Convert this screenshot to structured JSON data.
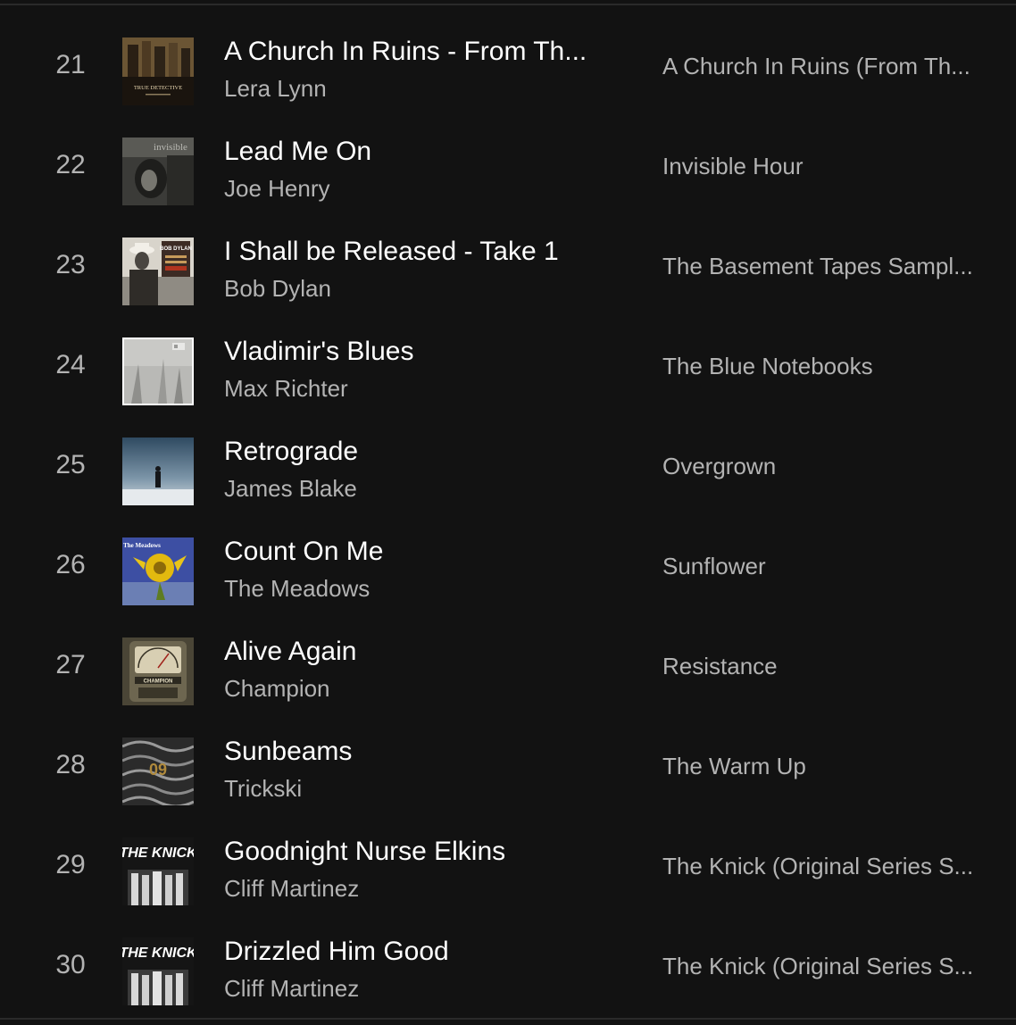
{
  "tracks": [
    {
      "number": "21",
      "title": "A Church In Ruins - From Th...",
      "artist": "Lera Lynn",
      "album": "A Church In Ruins (From Th...",
      "art_icon": "true-detective-album-art"
    },
    {
      "number": "22",
      "title": "Lead Me On",
      "artist": "Joe Henry",
      "album": "Invisible Hour",
      "art_icon": "invisible-hour-album-art"
    },
    {
      "number": "23",
      "title": "I Shall be Released - Take 1",
      "artist": "Bob Dylan",
      "album": "The Basement Tapes Sampl...",
      "art_icon": "basement-tapes-album-art"
    },
    {
      "number": "24",
      "title": "Vladimir's Blues",
      "artist": "Max Richter",
      "album": "The Blue Notebooks",
      "art_icon": "blue-notebooks-album-art"
    },
    {
      "number": "25",
      "title": "Retrograde",
      "artist": "James Blake",
      "album": "Overgrown",
      "art_icon": "overgrown-album-art"
    },
    {
      "number": "26",
      "title": "Count On Me",
      "artist": "The Meadows",
      "album": "Sunflower",
      "art_icon": "sunflower-album-art"
    },
    {
      "number": "27",
      "title": "Alive Again",
      "artist": "Champion",
      "album": "Resistance",
      "art_icon": "resistance-album-art"
    },
    {
      "number": "28",
      "title": "Sunbeams",
      "artist": "Trickski",
      "album": "The Warm Up",
      "art_icon": "warm-up-album-art"
    },
    {
      "number": "29",
      "title": "Goodnight Nurse Elkins",
      "artist": "Cliff Martinez",
      "album": "The Knick (Original Series S...",
      "art_icon": "the-knick-album-art"
    },
    {
      "number": "30",
      "title": "Drizzled Him Good",
      "artist": "Cliff Martinez",
      "album": "The Knick (Original Series S...",
      "art_icon": "the-knick-album-art"
    }
  ],
  "art_text": {
    "true_detective": "TRUE DETECTIVE",
    "invisible": "invisible",
    "bob_dylan": "BOB DYLAN",
    "meadows": "The Meadows",
    "champion": "CHAMPION",
    "warm_up_number": "09",
    "the_knick": "THE KNICK"
  },
  "colors": {
    "background": "#121212",
    "primary_text": "#ffffff",
    "secondary_text": "#b3b3b3"
  }
}
